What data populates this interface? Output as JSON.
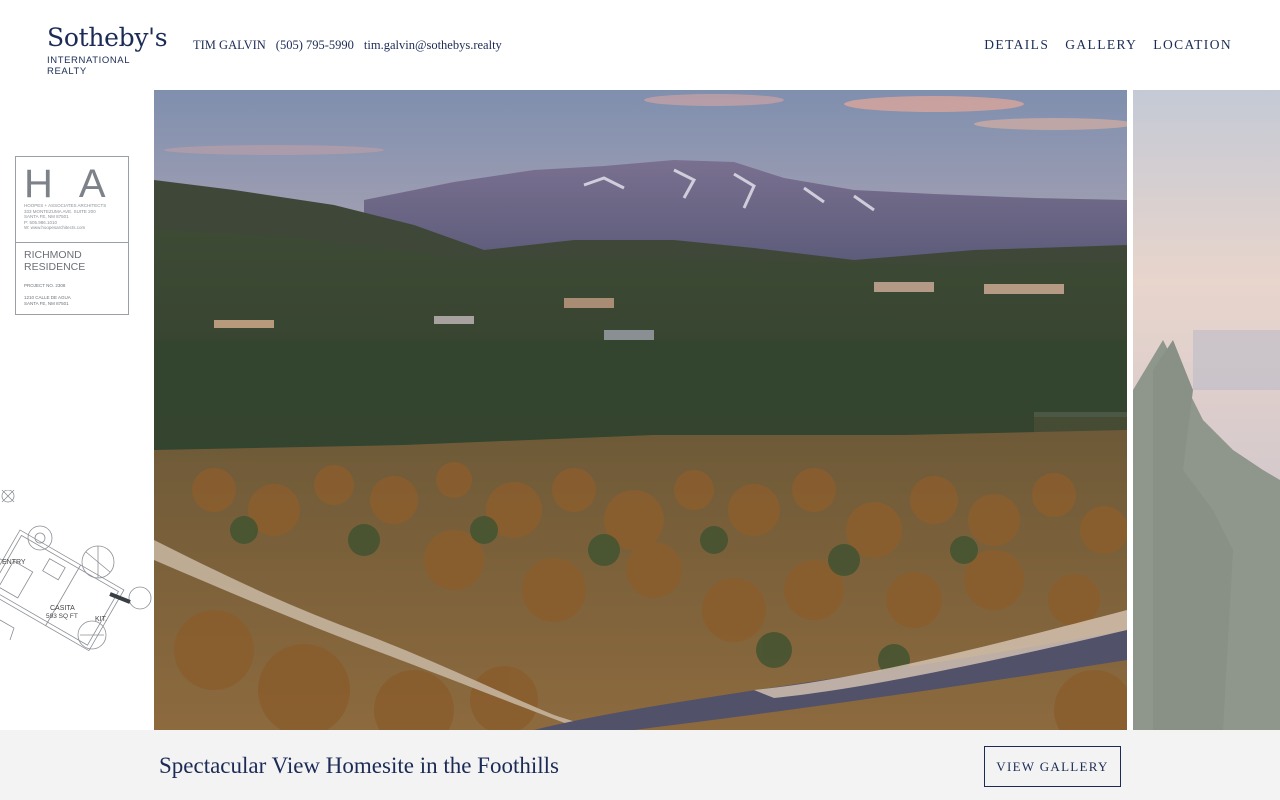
{
  "brand": {
    "name": "Sotheby's",
    "subtitle": "INTERNATIONAL REALTY"
  },
  "agent": {
    "name": "TIM GALVIN",
    "phone": "(505) 795-5990",
    "email": "tim.galvin@sothebys.realty"
  },
  "nav": {
    "items": [
      "DETAILS",
      "GALLERY",
      "LOCATION"
    ]
  },
  "plan": {
    "logo": "HA",
    "firm_lines": [
      "HOOPES + ASSOCIATES ARCHITECTS",
      "333 MONTEZUMA AVE. SUITE 200",
      "SANTA FE, NM 87501",
      "P: 505.986.1010",
      "W: www.hoopesarchitects.com"
    ],
    "project_name": "RICHMOND RESIDENCE",
    "project_no": "PROJECT NO. 2308",
    "address_lines": [
      "1210 CALLE DE AGUA",
      "SANTA FE, NM 87501"
    ],
    "rooms": {
      "entry": "ENTRY",
      "casita": "CASITA",
      "casita_size": "593 SQ FT",
      "kitchen": "KIT."
    }
  },
  "listing": {
    "title": "Spectacular View Homesite in the Foothills",
    "button": "VIEW GALLERY"
  },
  "colors": {
    "navy": "#1b2b55",
    "footer_bg": "#f3f3f3"
  }
}
